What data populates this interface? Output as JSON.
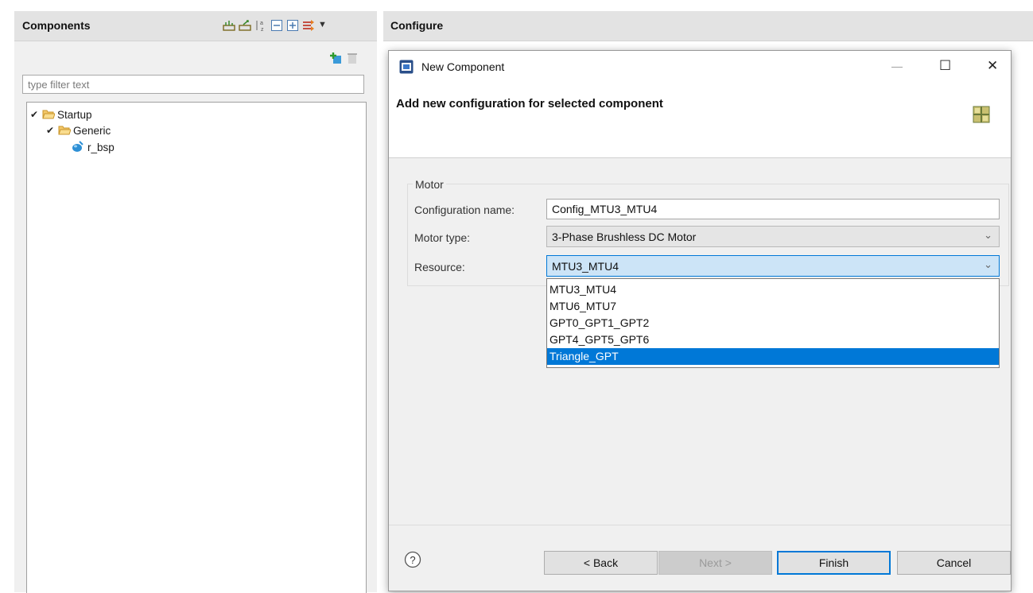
{
  "left_panel": {
    "title": "Components",
    "toolbar_icons": [
      "add-component-icon",
      "remove-component-icon",
      "sort-alpha-icon",
      "collapse-all-icon",
      "expand-all-icon",
      "filter-icon",
      "view-menu-icon"
    ],
    "actions": [
      "new-component-icon",
      "remove-icon"
    ],
    "filter": {
      "placeholder": "type filter text",
      "value": ""
    },
    "tree": [
      {
        "label": "Startup",
        "level": 0,
        "type": "folder",
        "expanded": true
      },
      {
        "label": "Generic",
        "level": 1,
        "type": "folder",
        "expanded": true
      },
      {
        "label": "r_bsp",
        "level": 2,
        "type": "component"
      }
    ]
  },
  "right_panel": {
    "title": "Configure"
  },
  "dialog": {
    "title": "New Component",
    "window_controls": {
      "minimize": "—",
      "maximize": "☐",
      "close": "✕"
    },
    "banner_title": "Add new configuration for selected component",
    "group_label": "Motor",
    "fields": {
      "config_name_label": "Configuration name:",
      "config_name_value": "Config_MTU3_MTU4",
      "motor_type_label": "Motor type:",
      "motor_type_value": "3-Phase Brushless DC Motor",
      "resource_label": "Resource:",
      "resource_value": "MTU3_MTU4"
    },
    "resource_options": [
      "MTU3_MTU4",
      "MTU6_MTU7",
      "GPT0_GPT1_GPT2",
      "GPT4_GPT5_GPT6",
      "Triangle_GPT"
    ],
    "resource_highlighted": "Triangle_GPT",
    "help_label": "?",
    "buttons": {
      "back": "< Back",
      "next": "Next >",
      "finish": "Finish",
      "cancel": "Cancel"
    }
  },
  "colors": {
    "accent": "#0078d7",
    "panel_bg": "#f0f0f0",
    "header_bg": "#e3e3e3"
  }
}
